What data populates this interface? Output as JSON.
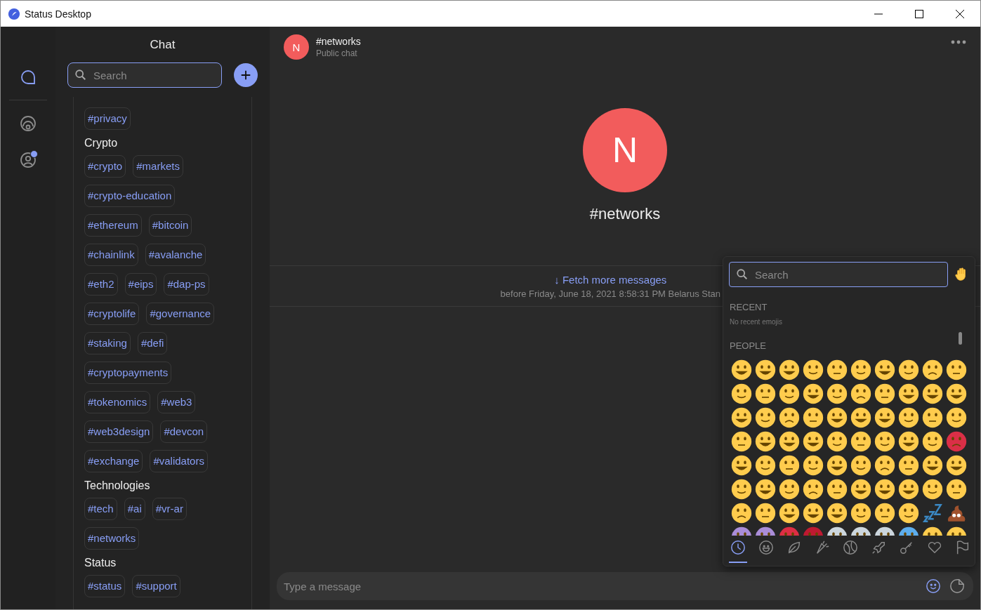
{
  "window": {
    "title": "Status Desktop"
  },
  "rail": [
    {
      "kind": "chat",
      "selected": true,
      "notification": false
    },
    {
      "kind": "browser",
      "selected": false,
      "notification": false
    },
    {
      "kind": "profile",
      "selected": false,
      "notification": true
    }
  ],
  "sidebar": {
    "title": "Chat",
    "search": {
      "placeholder": "Search"
    },
    "groups": [
      {
        "rows": [
          [
            "#privacy"
          ]
        ]
      },
      {
        "heading": "Crypto",
        "rows": [
          [
            "#crypto",
            "#markets"
          ],
          [
            "#crypto-education"
          ],
          [
            "#ethereum",
            "#bitcoin"
          ],
          [
            "#chainlink",
            "#avalanche"
          ],
          [
            "#eth2",
            "#eips",
            "#dap-ps"
          ],
          [
            "#cryptolife",
            "#governance"
          ],
          [
            "#staking",
            "#defi"
          ],
          [
            "#cryptopayments"
          ],
          [
            "#tokenomics",
            "#web3"
          ],
          [
            "#web3design",
            "#devcon"
          ],
          [
            "#exchange",
            "#validators"
          ]
        ]
      },
      {
        "heading": "Technologies",
        "rows": [
          [
            "#tech",
            "#ai",
            "#vr-ar"
          ],
          [
            "#networks"
          ]
        ]
      },
      {
        "heading": "Status",
        "rows": [
          [
            "#status",
            "#support"
          ]
        ]
      }
    ]
  },
  "chat": {
    "avatar": "N",
    "name": "#networks",
    "subtitle": "Public chat",
    "intro_avatar": "N",
    "intro_title": "#networks",
    "fetch": {
      "link": "↓ Fetch more messages",
      "note": "before Friday, June 18, 2021 8:58:31 PM Belarus Stan"
    },
    "input": {
      "placeholder": "Type a message"
    }
  },
  "emoji_picker": {
    "search": {
      "placeholder": "Search"
    },
    "sections": [
      {
        "title": "RECENT",
        "empty": "No recent emojis"
      },
      {
        "title": "PEOPLE"
      }
    ],
    "categories": [
      {
        "kind": "recent",
        "selected": true
      },
      {
        "kind": "smileys",
        "selected": false
      },
      {
        "kind": "nature",
        "selected": false
      },
      {
        "kind": "food",
        "selected": false
      },
      {
        "kind": "activity",
        "selected": false
      },
      {
        "kind": "travel",
        "selected": false
      },
      {
        "kind": "objects",
        "selected": false
      },
      {
        "kind": "symbols",
        "selected": false
      },
      {
        "kind": "flags",
        "selected": false
      }
    ]
  }
}
